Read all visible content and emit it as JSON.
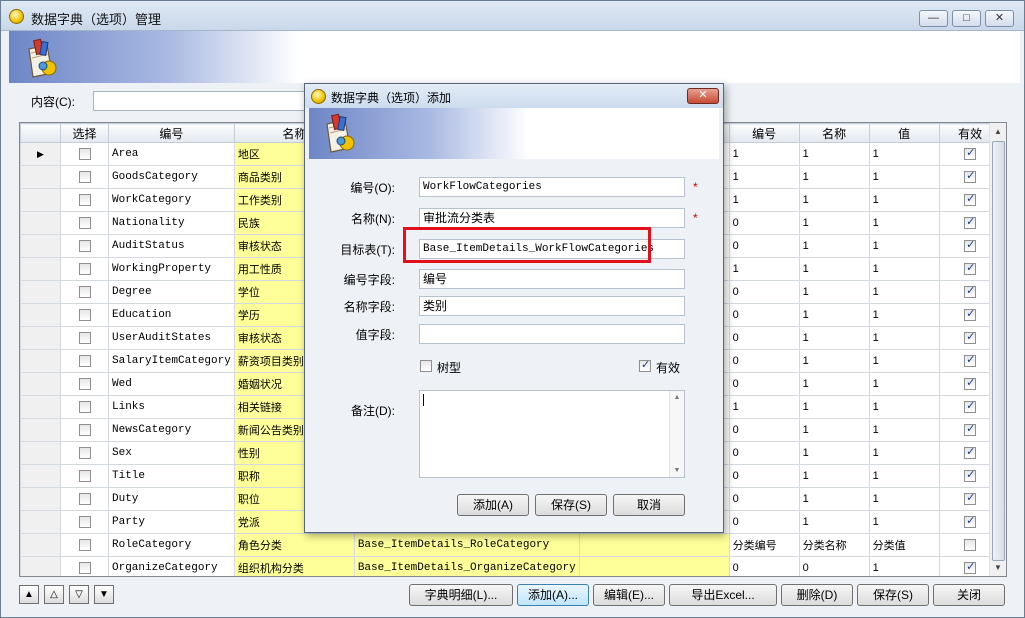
{
  "window": {
    "title": "数据字典（选项）管理",
    "minimize": "—",
    "maximize": "□",
    "close": "✕"
  },
  "search": {
    "label": "内容(C):",
    "value": ""
  },
  "grid": {
    "columns": [
      "选择",
      "编号",
      "名称",
      "编号",
      "名称",
      "值",
      "有效"
    ],
    "rows": [
      {
        "code": "Area",
        "name": "地区",
        "c3": "",
        "c4": "1",
        "c5": "1",
        "valid": true,
        "selected": false
      },
      {
        "code": "GoodsCategory",
        "name": "商品类别",
        "c3": "",
        "c4": "1",
        "c5": "1",
        "valid": true,
        "selected": false
      },
      {
        "code": "WorkCategory",
        "name": "工作类别",
        "c3": "",
        "c4": "1",
        "c5": "1",
        "valid": true,
        "selected": false
      },
      {
        "code": "Nationality",
        "name": "民族",
        "c3": "",
        "c4": "0",
        "c5": "1",
        "valid": true,
        "selected": false
      },
      {
        "code": "AuditStatus",
        "name": "审核状态",
        "c3": "",
        "c4": "0",
        "c5": "1",
        "valid": true,
        "selected": false
      },
      {
        "code": "WorkingProperty",
        "name": "用工性质",
        "c3": "",
        "c4": "1",
        "c5": "1",
        "valid": true,
        "selected": false
      },
      {
        "code": "Degree",
        "name": "学位",
        "c3": "",
        "c4": "0",
        "c5": "1",
        "valid": true,
        "selected": false
      },
      {
        "code": "Education",
        "name": "学历",
        "c3": "",
        "c4": "0",
        "c5": "1",
        "valid": true,
        "selected": false
      },
      {
        "code": "UserAuditStates",
        "name": "审核状态",
        "c3": "",
        "c4": "0",
        "c5": "1",
        "valid": true,
        "selected": false
      },
      {
        "code": "SalaryItemCategory",
        "name": "薪资项目类别",
        "c3": "",
        "c4": "0",
        "c5": "1",
        "valid": true,
        "selected": false
      },
      {
        "code": "Wed",
        "name": "婚姻状况",
        "c3": "",
        "c4": "0",
        "c5": "1",
        "valid": true,
        "selected": false
      },
      {
        "code": "Links",
        "name": "相关链接",
        "c3": "",
        "c4": "1",
        "c5": "1",
        "valid": true,
        "selected": false
      },
      {
        "code": "NewsCategory",
        "name": "新闻公告类别",
        "c3": "",
        "c4": "0",
        "c5": "1",
        "valid": true,
        "selected": false
      },
      {
        "code": "Sex",
        "name": "性别",
        "c3": "",
        "c4": "0",
        "c5": "1",
        "valid": true,
        "selected": false
      },
      {
        "code": "Title",
        "name": "职称",
        "c3": "",
        "c4": "0",
        "c5": "1",
        "valid": true,
        "selected": false
      },
      {
        "code": "Duty",
        "name": "职位",
        "c3": "",
        "c4": "0",
        "c5": "1",
        "valid": true,
        "selected": false
      },
      {
        "code": "Party",
        "name": "党派",
        "c3": "",
        "c4": "0",
        "c5": "1",
        "valid": true,
        "selected": false
      },
      {
        "code": "RoleCategory",
        "name": "角色分类",
        "c3": "Base_ItemDetails_RoleCategory",
        "c4": "分类编号",
        "c5": "分类名称",
        "c6": "分类值",
        "valid": false,
        "selected": false
      },
      {
        "code": "OrganizeCategory",
        "name": "组织机构分类",
        "c3": "Base_ItemDetails_OrganizeCategory",
        "c4": "0",
        "c5": "0",
        "c6": "1",
        "valid": true,
        "selected": false
      }
    ]
  },
  "bottom": {
    "nav": [
      "▲",
      "△",
      "▽",
      "▼"
    ],
    "buttons": {
      "details": "字典明细(L)...",
      "add": "添加(A)...",
      "edit": "编辑(E)...",
      "export": "导出Excel...",
      "delete": "删除(D)",
      "save": "保存(S)",
      "close": "关闭"
    }
  },
  "dialog": {
    "title": "数据字典（选项）添加",
    "close": "✕",
    "fields": {
      "code_label": "编号(O):",
      "code_value": "WorkFlowCategories",
      "name_label": "名称(N):",
      "name_value": "审批流分类表",
      "target_label": "目标表(T):",
      "target_value": "Base_ItemDetails_WorkFlowCategories",
      "code_field_label": "编号字段:",
      "code_field_value": "编号",
      "name_field_label": "名称字段:",
      "name_field_value": "类别",
      "value_field_label": "值字段:",
      "value_field_value": "",
      "tree_label": "树型",
      "tree_checked": false,
      "valid_label": "有效",
      "valid_checked": true,
      "remark_label": "备注(D):",
      "remark_value": "",
      "required_mark": "*"
    },
    "buttons": {
      "add": "添加(A)",
      "save": "保存(S)",
      "cancel": "取消"
    }
  }
}
